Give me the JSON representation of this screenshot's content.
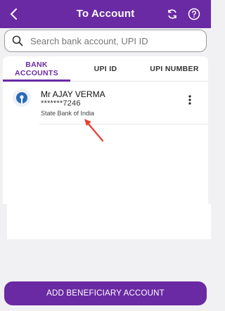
{
  "header": {
    "title": "To Account",
    "bg_color": "#6a2aa3"
  },
  "search": {
    "placeholder": "Search bank account, UPI ID",
    "value": ""
  },
  "tabs": [
    {
      "label": "BANK\nACCOUNTS",
      "active": true
    },
    {
      "label": "UPI ID",
      "active": false
    },
    {
      "label": "UPI NUMBER",
      "active": false
    }
  ],
  "accounts": [
    {
      "holder": "Mr AJAY VERMA",
      "number": "*******7246",
      "bank": "State Bank of India",
      "logo_icon": "sbi-logo-icon",
      "logo_color": "#2a6ab8"
    }
  ],
  "cta": {
    "label": "ADD BENEFICIARY ACCOUNT"
  },
  "annotation": {
    "arrow_color": "#e8403a"
  }
}
